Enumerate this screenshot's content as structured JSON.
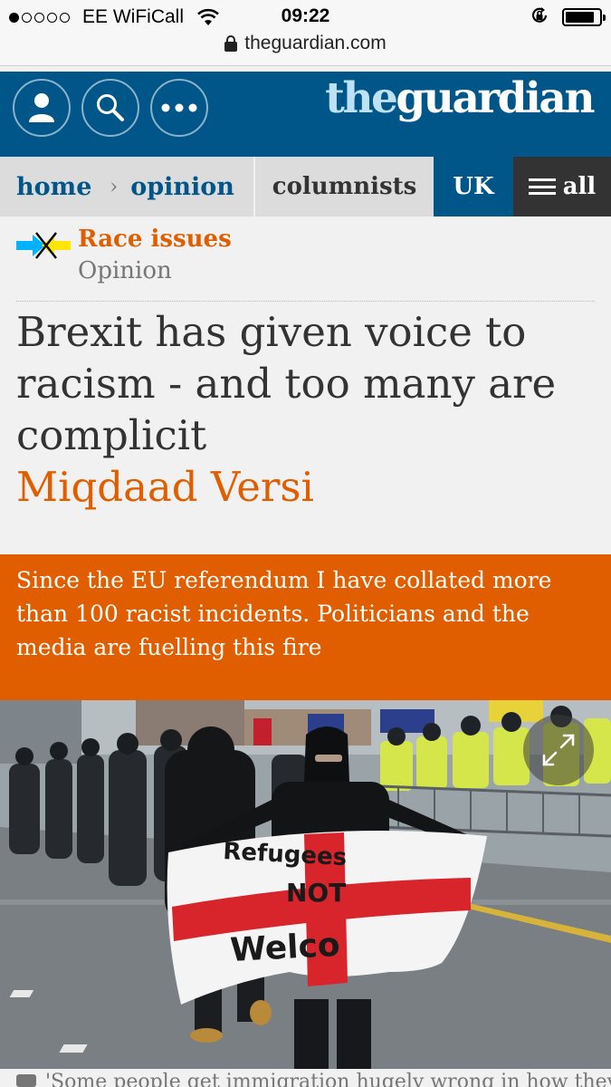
{
  "status_bar": {
    "carrier": "EE WiFiCall",
    "time": "09:22",
    "signal_bars": 1,
    "signal_total": 5,
    "battery_level": 0.85,
    "url": "theguardian.com"
  },
  "header": {
    "logo_the": "the",
    "logo_name": "guardian",
    "icons": [
      "profile-icon",
      "search-icon",
      "more-icon"
    ]
  },
  "nav": {
    "home": "home",
    "separator": "›",
    "opinion": "opinion",
    "columnists": "columnists",
    "edition": "UK",
    "all": "all"
  },
  "article": {
    "section": "Race issues",
    "subsection": "Opinion",
    "headline": "Brexit has given voice to racism - and too many are complicit",
    "byline": "Miqdaad Versi",
    "standfirst": "Since the EU referendum I have collated more than 100 racist incidents. Politicians and the media are fuelling this fire",
    "photo_banner_text": [
      "Refugees",
      "NOT",
      "Welco"
    ],
    "caption": "'Some people get immigration hugely wrong in how they"
  },
  "colors": {
    "guardian_blue": "#005689",
    "logo_light_blue": "#bde1f5",
    "opinion_orange": "#e05e00",
    "nav_grey": "#dcdcdc",
    "nav_dark": "#333333",
    "page_bg": "#f1f1f1"
  }
}
